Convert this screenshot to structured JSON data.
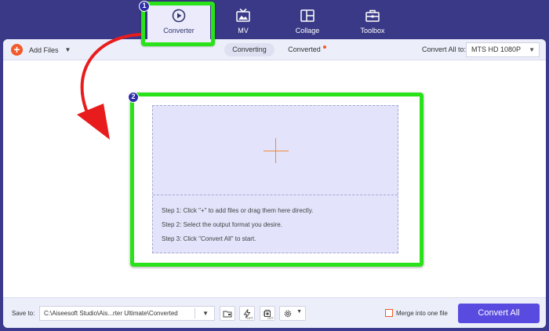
{
  "nav": {
    "tabs": [
      {
        "label": "Converter",
        "icon": "converter-icon",
        "active": true
      },
      {
        "label": "MV",
        "icon": "mv-icon",
        "active": false
      },
      {
        "label": "Collage",
        "icon": "collage-icon",
        "active": false
      },
      {
        "label": "Toolbox",
        "icon": "toolbox-icon",
        "active": false
      }
    ]
  },
  "badges": {
    "first": "1",
    "second": "2"
  },
  "toolbar": {
    "add_files_label": "Add Files",
    "seg_converting": "Converting",
    "seg_converted": "Converted",
    "convert_all_to_label": "Convert All to:",
    "format_value": "MTS HD 1080P"
  },
  "dropzone": {
    "step1": "Step 1: Click \"+\" to add files or drag them here directly.",
    "step2": "Step 2: Select the output format you desire.",
    "step3": "Step 3: Click \"Convert All\" to start."
  },
  "bottom": {
    "save_to_label": "Save to:",
    "path_value": "C:\\Aiseesoft Studio\\Ais...rter Ultimate\\Converted",
    "hw_accel_off": "OFF",
    "gpu_off": "OFF",
    "merge_label": "Merge into one file",
    "convert_all_label": "Convert All"
  },
  "colors": {
    "header_bg": "#3a3987",
    "highlight_green": "#2ae21a",
    "accent_orange": "#f15a2b",
    "primary_button": "#5a4be0",
    "dropzone_bg": "#e3e3fb",
    "annotation_arrow": "#e81c1c"
  }
}
